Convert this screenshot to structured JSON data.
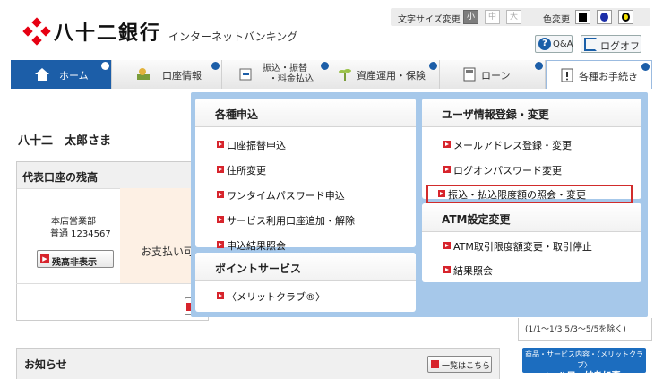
{
  "header": {
    "bank_name": "八十二銀行",
    "service_name": "インターネットバンキング",
    "font_size": {
      "label": "文字サイズ変更",
      "options": [
        "小",
        "中",
        "大"
      ],
      "selected": "小"
    },
    "color_change": {
      "label": "色変更",
      "options": [
        "#000000",
        "#1c2fa8",
        "#f3e100"
      ]
    },
    "qa_label": "Q&A",
    "logout_label": "ログオフ"
  },
  "nav": {
    "items": [
      {
        "label": "ホーム",
        "icon": "home-icon"
      },
      {
        "label": "口座情報",
        "icon": "money-icon"
      },
      {
        "label": "振込・振替",
        "label2": "・料金払込",
        "icon": "transfer-icon"
      },
      {
        "label": "資産運用・保険",
        "icon": "plant-icon"
      },
      {
        "label": "ローン",
        "icon": "calculator-icon"
      },
      {
        "label": "各種お手続き",
        "icon": "notice-icon"
      }
    ]
  },
  "main": {
    "greeting": "八十二　太郎さま",
    "balance_panel": {
      "title": "代表口座の残高",
      "branch": "本店営業部",
      "account": "普通 1234567",
      "hide_button": "残高非表示",
      "payment_text": "お支払い可"
    },
    "news": {
      "title": "お知らせ",
      "list_button": "一覧はこちら"
    }
  },
  "right": {
    "holiday_note": "(1/1～1/3  5/3～5/5を除く)",
    "hello_button_sub": "商品・サービス内容・〈メリットクラブ〉",
    "hello_button_main": "ハローはちに恋"
  },
  "mega_menu": {
    "applications": {
      "title": "各種申込",
      "items": [
        "口座振替申込",
        "住所変更",
        "ワンタイムパスワード申込",
        "サービス利用口座追加・解除",
        "申込結果照会"
      ]
    },
    "points": {
      "title": "ポイントサービス",
      "items": [
        "〈メリットクラブ®〉"
      ]
    },
    "user_info": {
      "title": "ユーザ情報登録・変更",
      "items": [
        "メールアドレス登録・変更",
        "ログオンパスワード変更",
        "振込・払込限度額の照会・変更"
      ],
      "selected_index": 2
    },
    "atm": {
      "title": "ATM設定変更",
      "items": [
        "ATM取引限度額変更・取引停止",
        "結果照会"
      ]
    }
  }
}
